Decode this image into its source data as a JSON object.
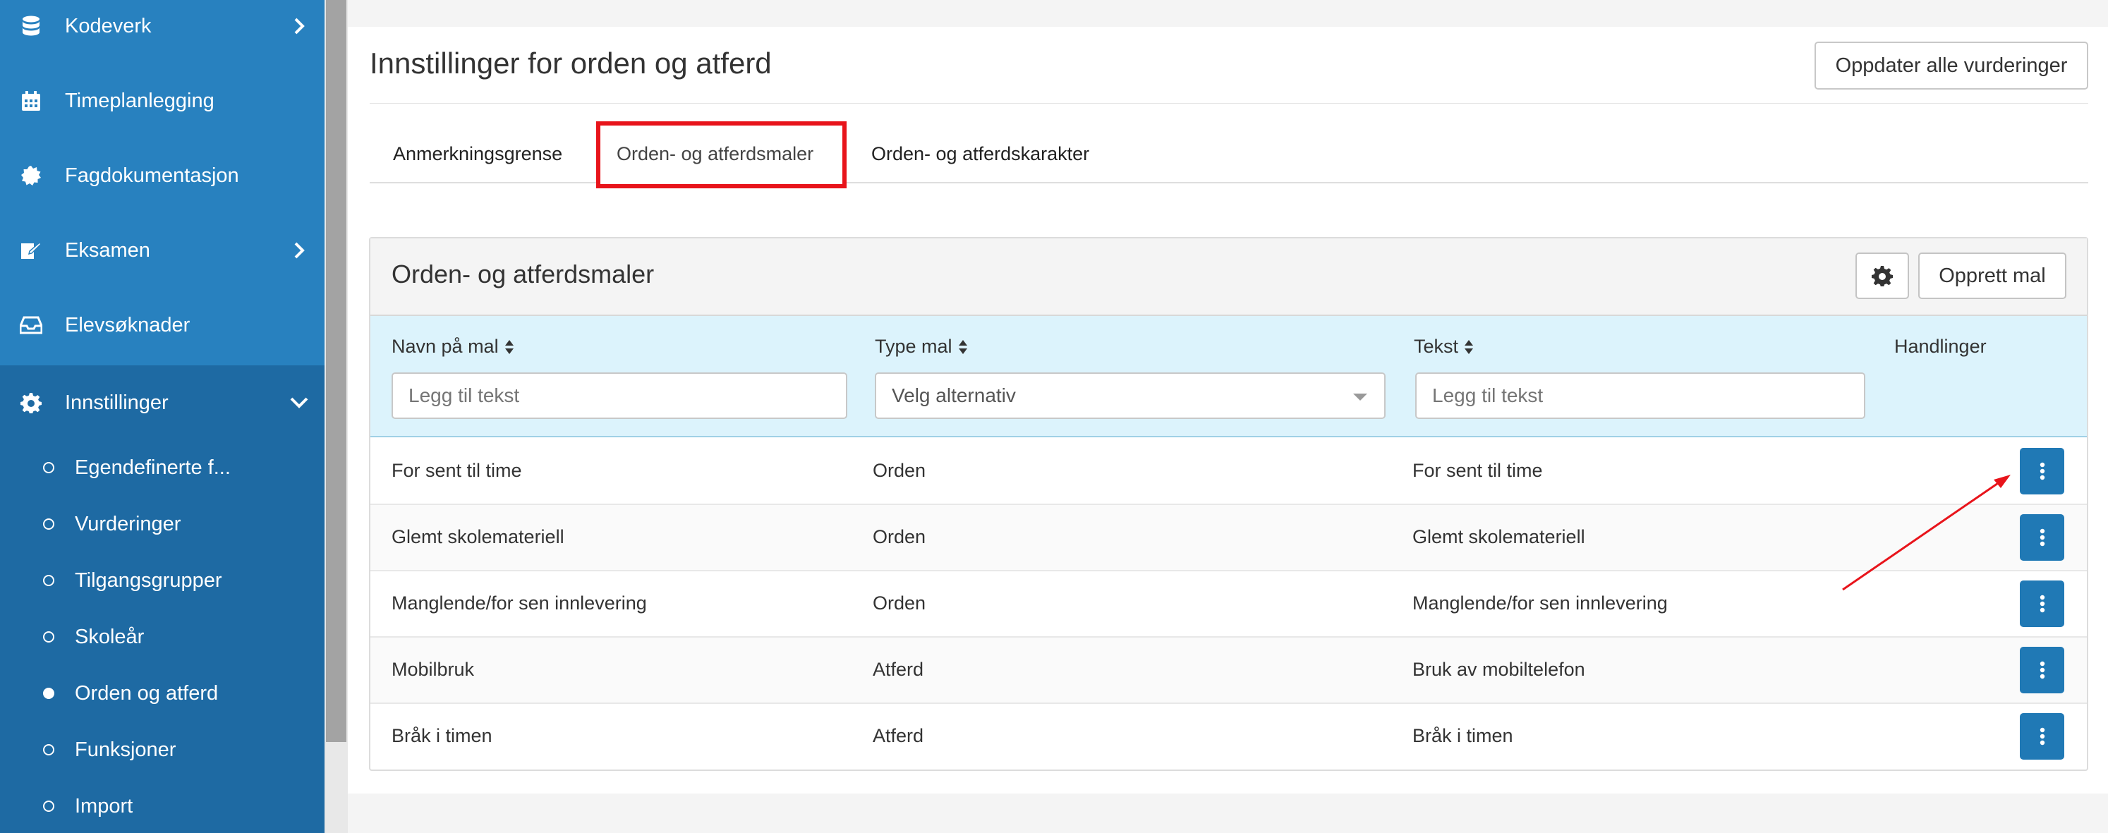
{
  "sidebar": {
    "items": [
      {
        "label": "Kodeverk",
        "icon": "database-icon",
        "expandable": true
      },
      {
        "label": "Timeplanlegging",
        "icon": "calendar-icon",
        "expandable": false
      },
      {
        "label": "Fagdokumentasjon",
        "icon": "certificate-icon",
        "expandable": false
      },
      {
        "label": "Eksamen",
        "icon": "edit-icon",
        "expandable": true
      },
      {
        "label": "Elevsøknader",
        "icon": "inbox-icon",
        "expandable": false
      },
      {
        "label": "Innstillinger",
        "icon": "gear-icon",
        "expandable": true,
        "expanded": true
      }
    ],
    "sub_items": [
      {
        "label": "Egendefinerte f...",
        "active": false
      },
      {
        "label": "Vurderinger",
        "active": false
      },
      {
        "label": "Tilgangsgrupper",
        "active": false
      },
      {
        "label": "Skoleår",
        "active": false
      },
      {
        "label": "Orden og atferd",
        "active": true
      },
      {
        "label": "Funksjoner",
        "active": false
      },
      {
        "label": "Import",
        "active": false
      }
    ]
  },
  "page": {
    "title": "Innstillinger for orden og atferd",
    "update_button": "Oppdater alle vurderinger"
  },
  "tabs": [
    {
      "label": "Anmerkningsgrense",
      "active": false
    },
    {
      "label": "Orden- og atferdsmaler",
      "active": true
    },
    {
      "label": "Orden- og atferdskarakter",
      "active": false
    }
  ],
  "panel": {
    "title": "Orden- og atferdsmaler",
    "create_button": "Opprett mal",
    "columns": {
      "name": "Navn på mal",
      "type": "Type mal",
      "text": "Tekst",
      "actions": "Handlinger"
    },
    "filters": {
      "name_placeholder": "Legg til tekst",
      "type_selected": "Velg alternativ",
      "text_placeholder": "Legg til tekst"
    },
    "rows": [
      {
        "name": "For sent til time",
        "type": "Orden",
        "text": "For sent til time"
      },
      {
        "name": "Glemt skolemateriell",
        "type": "Orden",
        "text": "Glemt skolemateriell"
      },
      {
        "name": "Manglende/for sen innlevering",
        "type": "Orden",
        "text": "Manglende/for sen innlevering"
      },
      {
        "name": "Mobilbruk",
        "type": "Atferd",
        "text": "Bruk av mobiltelefon"
      },
      {
        "name": "Bråk i timen",
        "type": "Atferd",
        "text": "Bråk i timen"
      }
    ]
  },
  "colors": {
    "sidebar": "#2881bf",
    "sidebar_section": "#1e6aa3",
    "primary_button": "#2079b5",
    "header_row": "#dcf3fc",
    "annotation_red": "#e8141b"
  }
}
